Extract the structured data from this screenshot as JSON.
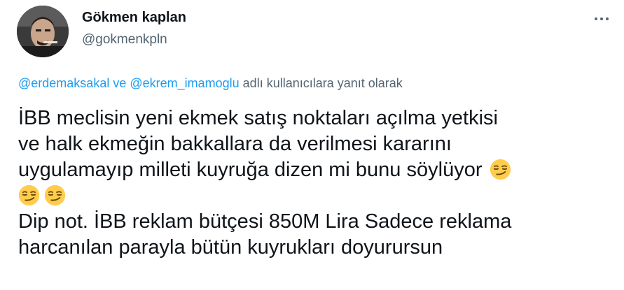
{
  "author": {
    "display_name": "Gökmen kaplan",
    "handle": "@gokmenkpln"
  },
  "more_menu": {
    "icon": "more-horizontal-icon"
  },
  "reply_context": {
    "mention_1": "@erdemaksakal",
    "connector": " ve ",
    "mention_2": "@ekrem_imamoglu",
    "suffix": " adlı kullanıcılara yanıt olarak"
  },
  "tweet": {
    "line_1": "İBB meclisin yeni ekmek satış noktaları açılma yetkisi",
    "line_2": "ve halk ekmeğin bakkallara da verilmesi kararını",
    "line_3": "uygulamayıp milleti kuyruğa dizen mi bunu söylüyor",
    "line_5": "Dip not. İBB reklam bütçesi 850M Lira Sadece reklama",
    "line_6": "harcanılan parayla bütün kuyrukları doyurursun",
    "emoji_name": "smirking-face-emoji",
    "emoji_count": 3
  },
  "colors": {
    "text": "#0f1419",
    "secondary": "#536471",
    "link": "#1d9bf0",
    "emoji_fill": "#ffcc4d"
  }
}
